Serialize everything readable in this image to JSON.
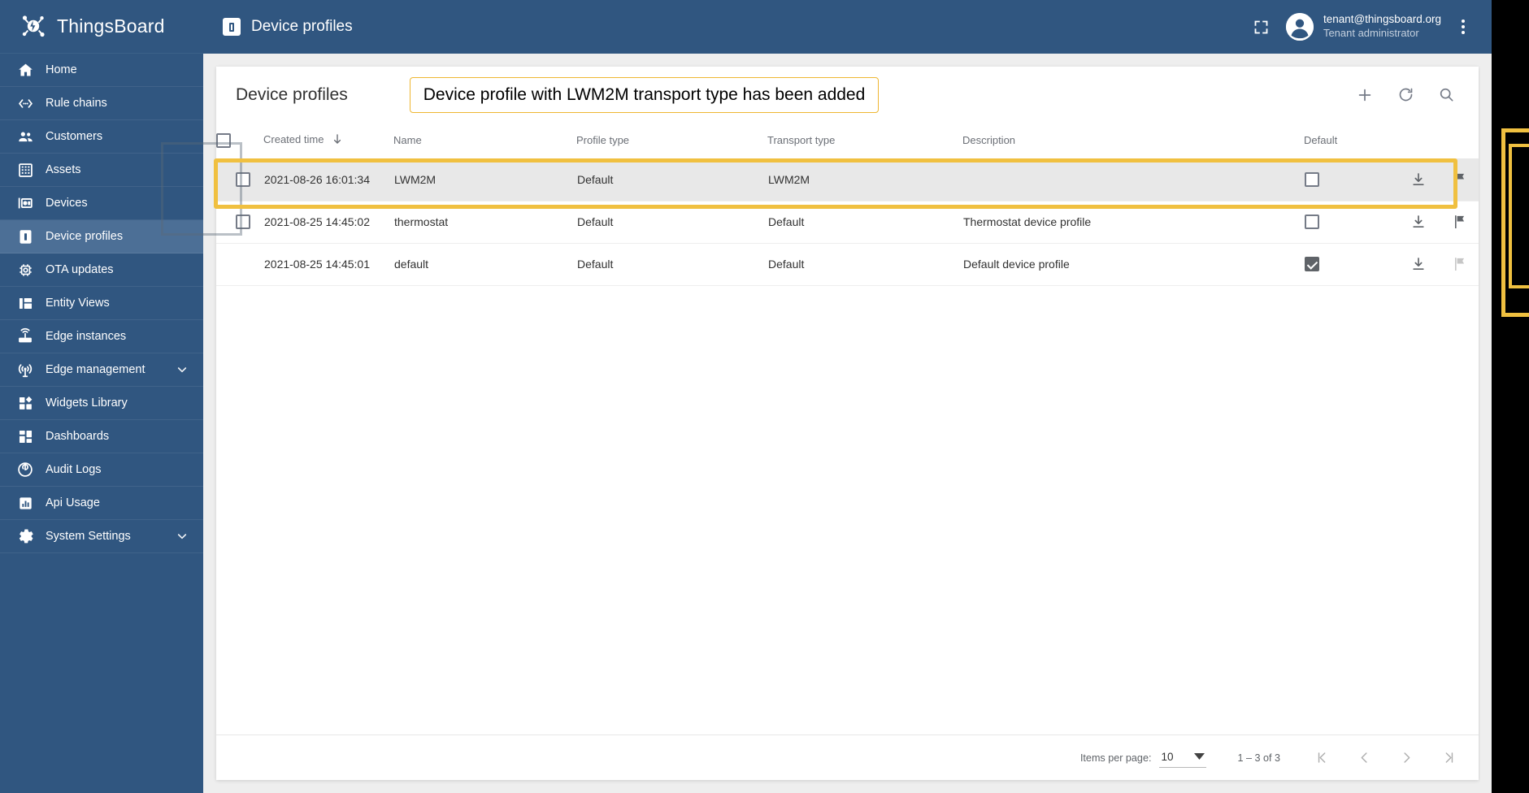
{
  "brand": {
    "name": "ThingsBoard",
    "logo_icon": "thingsboard-logo-icon"
  },
  "sidebar": {
    "items": [
      {
        "label": "Home",
        "icon": "home-icon",
        "active": false,
        "expandable": false
      },
      {
        "label": "Rule chains",
        "icon": "rule-chains-icon",
        "active": false,
        "expandable": false
      },
      {
        "label": "Customers",
        "icon": "customers-icon",
        "active": false,
        "expandable": false
      },
      {
        "label": "Assets",
        "icon": "assets-icon",
        "active": false,
        "expandable": false
      },
      {
        "label": "Devices",
        "icon": "devices-icon",
        "active": false,
        "expandable": false
      },
      {
        "label": "Device profiles",
        "icon": "device-profiles-icon",
        "active": true,
        "expandable": false
      },
      {
        "label": "OTA updates",
        "icon": "ota-updates-icon",
        "active": false,
        "expandable": false
      },
      {
        "label": "Entity Views",
        "icon": "entity-views-icon",
        "active": false,
        "expandable": false
      },
      {
        "label": "Edge instances",
        "icon": "edge-instances-icon",
        "active": false,
        "expandable": false
      },
      {
        "label": "Edge management",
        "icon": "edge-management-icon",
        "active": false,
        "expandable": true
      },
      {
        "label": "Widgets Library",
        "icon": "widgets-library-icon",
        "active": false,
        "expandable": false
      },
      {
        "label": "Dashboards",
        "icon": "dashboards-icon",
        "active": false,
        "expandable": false
      },
      {
        "label": "Audit Logs",
        "icon": "audit-logs-icon",
        "active": false,
        "expandable": false
      },
      {
        "label": "Api Usage",
        "icon": "api-usage-icon",
        "active": false,
        "expandable": false
      },
      {
        "label": "System Settings",
        "icon": "system-settings-icon",
        "active": false,
        "expandable": true
      }
    ]
  },
  "topbar": {
    "title": "Device profiles",
    "page_icon": "device-profile-icon",
    "fullscreen_icon": "fullscreen-icon",
    "user_email": "tenant@thingsboard.org",
    "user_role": "Tenant administrator",
    "avatar_icon": "account-circle-icon",
    "menu_icon": "more-vert-icon"
  },
  "card": {
    "title": "Device profiles",
    "callout_text": "Device profile with LWM2M transport type has been added",
    "callout_border_color": "#eeb732",
    "actions": [
      {
        "name": "add-device-profile-button",
        "icon": "plus-icon"
      },
      {
        "name": "refresh-button",
        "icon": "refresh-icon"
      },
      {
        "name": "search-button",
        "icon": "search-icon"
      }
    ]
  },
  "table": {
    "columns": [
      {
        "key": "created",
        "label": "Created time",
        "sorted": true,
        "sort_dir": "desc"
      },
      {
        "key": "name",
        "label": "Name"
      },
      {
        "key": "profile_type",
        "label": "Profile type"
      },
      {
        "key": "transport_type",
        "label": "Transport type"
      },
      {
        "key": "description",
        "label": "Description"
      },
      {
        "key": "default",
        "label": "Default"
      }
    ],
    "header_checkbox_checked": false,
    "rows": [
      {
        "created": "2021-08-26 16:01:34",
        "name": "LWM2M",
        "profile_type": "Default",
        "transport_type": "LWM2M",
        "description": "",
        "is_default": false,
        "selectable": true,
        "highlighted": true,
        "actions_disabled": false
      },
      {
        "created": "2021-08-25 14:45:02",
        "name": "thermostat",
        "profile_type": "Default",
        "transport_type": "Default",
        "description": "Thermostat device profile",
        "is_default": false,
        "selectable": true,
        "highlighted": false,
        "actions_disabled": false
      },
      {
        "created": "2021-08-25 14:45:01",
        "name": "default",
        "profile_type": "Default",
        "transport_type": "Default",
        "description": "Default device profile",
        "is_default": true,
        "selectable": false,
        "highlighted": false,
        "actions_disabled": true
      }
    ],
    "row_actions": [
      {
        "name": "export-row-button",
        "icon": "download-icon"
      },
      {
        "name": "make-default-row-button",
        "icon": "flag-icon"
      },
      {
        "name": "delete-row-button",
        "icon": "delete-icon"
      }
    ]
  },
  "paginator": {
    "items_per_page_label": "Items per page:",
    "items_per_page_value": "10",
    "range_label": "1 – 3 of 3",
    "first_page_icon": "first-page-icon",
    "prev_page_icon": "prev-page-icon",
    "next_page_icon": "next-page-icon",
    "last_page_icon": "last-page-icon"
  },
  "annotation": {
    "highlight_color": "#f0c040"
  }
}
